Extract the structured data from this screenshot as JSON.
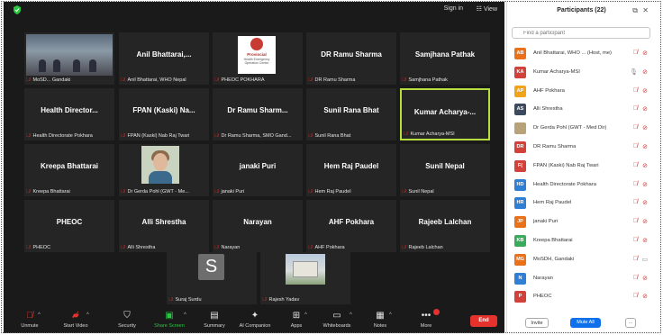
{
  "meeting": {
    "topbar": {
      "sign_in": "Sign in",
      "view": "View"
    },
    "tiles_row1": [
      {
        "name": "",
        "tag": "MoSD... Gandaki",
        "kind": "room"
      },
      {
        "name": "Anil Bhattarai,...",
        "tag": "Anil Bhattarai, WHO Nepal"
      },
      {
        "name": "",
        "tag": "PHEOC POKHARA",
        "kind": "slide",
        "slide_title": "Provincial",
        "slide_sub": "Health Emergency Operation Center"
      },
      {
        "name": "DR Ramu Sharma",
        "tag": "DR Ramu Sharma"
      },
      {
        "name": "Samjhana Pathak",
        "tag": "Samjhana Pathak"
      }
    ],
    "tiles_row2": [
      {
        "name": "Health Director...",
        "tag": "Health Directorate Pokhara"
      },
      {
        "name": "FPAN (Kaski) Na...",
        "tag": "FPAN (Kaski) Nab Raj Twari"
      },
      {
        "name": "Dr Ramu Sharm...",
        "tag": "Dr Ramu Sharma, SMO Gand..."
      },
      {
        "name": "Sunil Rana Bhat",
        "tag": "Sunil Rana Bhat"
      },
      {
        "name": "Kumar Acharya-...",
        "tag": "Kumar Acharya-MSI",
        "active": true
      }
    ],
    "tiles_row3": [
      {
        "name": "Kreepa Bhattarai",
        "tag": "Kreepa Bhattarai"
      },
      {
        "name": "",
        "tag": "Dr Gerda Pohl (GWT - Me...",
        "kind": "face"
      },
      {
        "name": "janaki Puri",
        "tag": "janaki Puri"
      },
      {
        "name": "Hem Raj Paudel",
        "tag": "Hem Raj Paudel"
      },
      {
        "name": "Sunil Nepal",
        "tag": "Sunil Nepal"
      }
    ],
    "tiles_row4": [
      {
        "name": "PHEOC",
        "tag": "PHEOC"
      },
      {
        "name": "Alli Shrestha",
        "tag": "Alli Shrestha"
      },
      {
        "name": "Narayan",
        "tag": "Narayan"
      },
      {
        "name": "AHF Pokhara",
        "tag": "AHF Pokhara"
      },
      {
        "name": "Rajeeb Lalchan",
        "tag": "Rajeeb Lalchan"
      }
    ],
    "tiles_row5": [
      {
        "name": "",
        "tag": "Suraj Surdu",
        "kind": "avatar",
        "initial": "S"
      },
      {
        "name": "",
        "tag": "Rajesh Yadav",
        "kind": "building"
      }
    ],
    "toolbar": {
      "unmute": "Unmute",
      "start_video": "Start Video",
      "security": "Security",
      "share_screen": "Share Screen",
      "summary": "Summary",
      "ai_companion": "AI Companion",
      "apps": "Apps",
      "whiteboards": "Whiteboards",
      "notes": "Notes",
      "more": "More",
      "end": "End"
    }
  },
  "panel": {
    "title": "Participants (22)",
    "search_placeholder": "Find a participant",
    "participants": [
      {
        "initials": "AB",
        "color": "#e8711a",
        "name": "Anil Bhattarai, WHO ... (Host, me)",
        "mic": "off",
        "cam": "off"
      },
      {
        "initials": "KA",
        "color": "#d2413a",
        "name": "Kumar Acharya-MSI",
        "mic": "on",
        "cam": "off"
      },
      {
        "initials": "AP",
        "color": "#f0a31b",
        "name": "AHF Pokhara",
        "mic": "off",
        "cam": "off"
      },
      {
        "initials": "AS",
        "color": "#3b4a5e",
        "name": "Alli Shrestha",
        "mic": "off",
        "cam": "off"
      },
      {
        "initials": "",
        "color": "#b8a27a",
        "name": "Dr Gerda Pohl (GWT - Med Dir)",
        "mic": "off",
        "cam": "off",
        "photo": true
      },
      {
        "initials": "DR",
        "color": "#d2413a",
        "name": "DR Ramu Sharma",
        "mic": "off",
        "cam": "off"
      },
      {
        "initials": "F(",
        "color": "#d2413a",
        "name": "FPAN (Kaski) Nab Raj Twari",
        "mic": "off",
        "cam": "off"
      },
      {
        "initials": "HD",
        "color": "#2f7fd4",
        "name": "Health Directorate Pokhara",
        "mic": "off",
        "cam": "off"
      },
      {
        "initials": "HR",
        "color": "#2f7fd4",
        "name": "Hem Raj Paudel",
        "mic": "off",
        "cam": "off"
      },
      {
        "initials": "JP",
        "color": "#e8711a",
        "name": "janaki Puri",
        "mic": "off",
        "cam": "off"
      },
      {
        "initials": "KB",
        "color": "#3aaa5c",
        "name": "Kreepa Bhattarai",
        "mic": "off",
        "cam": "off"
      },
      {
        "initials": "MG",
        "color": "#e8711a",
        "name": "MoSDH, Gandaki",
        "mic": "off",
        "cam": "on"
      },
      {
        "initials": "N",
        "color": "#2f7fd4",
        "name": "Narayan",
        "mic": "off",
        "cam": "off"
      },
      {
        "initials": "P",
        "color": "#d2413a",
        "name": "PHEOC",
        "mic": "off",
        "cam": "off"
      }
    ],
    "invite": "Invite",
    "mute_all": "Mute All",
    "more": "..."
  }
}
